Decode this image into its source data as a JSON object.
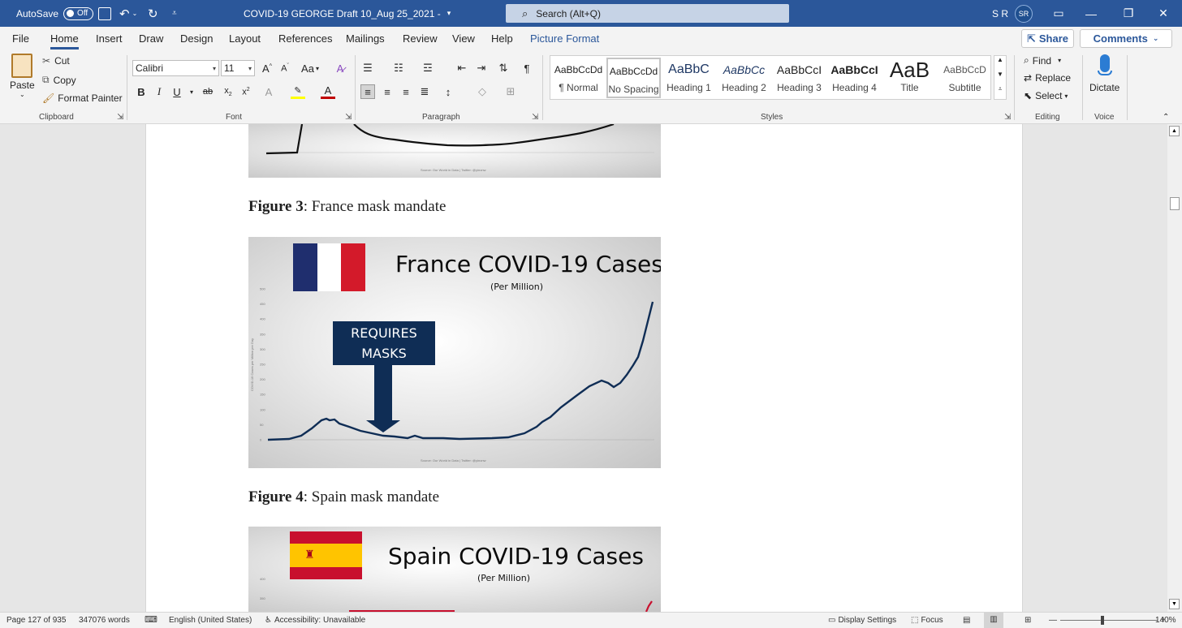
{
  "titlebar": {
    "autosave_label": "AutoSave",
    "autosave_state": "Off",
    "document_title": "COVID-19 GEORGE Draft 10_Aug 25_2021  -",
    "search_placeholder": "Search (Alt+Q)",
    "user_initials": "S R",
    "avatar_initials": "SR"
  },
  "tabs": [
    "File",
    "Home",
    "Insert",
    "Draw",
    "Design",
    "Layout",
    "References",
    "Mailings",
    "Review",
    "View",
    "Help",
    "Picture Format"
  ],
  "actions": {
    "share": "Share",
    "comments": "Comments"
  },
  "clipboard": {
    "paste": "Paste",
    "cut": "Cut",
    "copy": "Copy",
    "format_painter": "Format Painter",
    "group": "Clipboard"
  },
  "font": {
    "name": "Calibri",
    "size": "11",
    "case_label": "Aa",
    "group": "Font"
  },
  "paragraph": {
    "group": "Paragraph"
  },
  "styles": {
    "group": "Styles",
    "items": [
      {
        "preview": "AaBbCcDd",
        "name": "¶ Normal"
      },
      {
        "preview": "AaBbCcDd",
        "name": "No Spacing"
      },
      {
        "preview": "AaBbC",
        "name": "Heading 1"
      },
      {
        "preview": "AaBbCc",
        "name": "Heading 2"
      },
      {
        "preview": "AaBbCcI",
        "name": "Heading 3"
      },
      {
        "preview": "AaBbCcI",
        "name": "Heading 4"
      },
      {
        "preview": "AaB",
        "name": "Title"
      },
      {
        "preview": "AaBbCcD",
        "name": "Subtitle"
      }
    ]
  },
  "editing": {
    "find": "Find",
    "replace": "Replace",
    "select": "Select",
    "group": "Editing"
  },
  "voice": {
    "dictate": "Dictate",
    "group": "Voice"
  },
  "document": {
    "fig3_caption_bold": "Figure 3",
    "fig3_caption_text": ": France mask mandate",
    "fig4_caption_bold": "Figure 4",
    "fig4_caption_text": ": Spain mask mandate",
    "top_fig_source": "Source: Our World in Data | Twitter: @yinonw",
    "france": {
      "title": "France COVID-19 Cases",
      "subtitle": "(Per Million)",
      "callout": "REQUIRES MASKS",
      "y_axis_label": "COVID-19 Cases per Million per Day",
      "y_ticks": [
        "500",
        "450",
        "400",
        "350",
        "300",
        "250",
        "200",
        "150",
        "100",
        "50",
        "0"
      ],
      "source": "Source: Our World in Data | Twitter: @yinonw"
    },
    "spain": {
      "title": "Spain COVID-19 Cases",
      "subtitle": "(Per Million)",
      "y_ticks": [
        "400",
        "350"
      ]
    }
  },
  "status": {
    "page": "Page 127 of 935",
    "words": "347076 words",
    "language": "English (United States)",
    "accessibility": "Accessibility: Unavailable",
    "display_settings": "Display Settings",
    "focus": "Focus",
    "zoom": "140%"
  }
}
